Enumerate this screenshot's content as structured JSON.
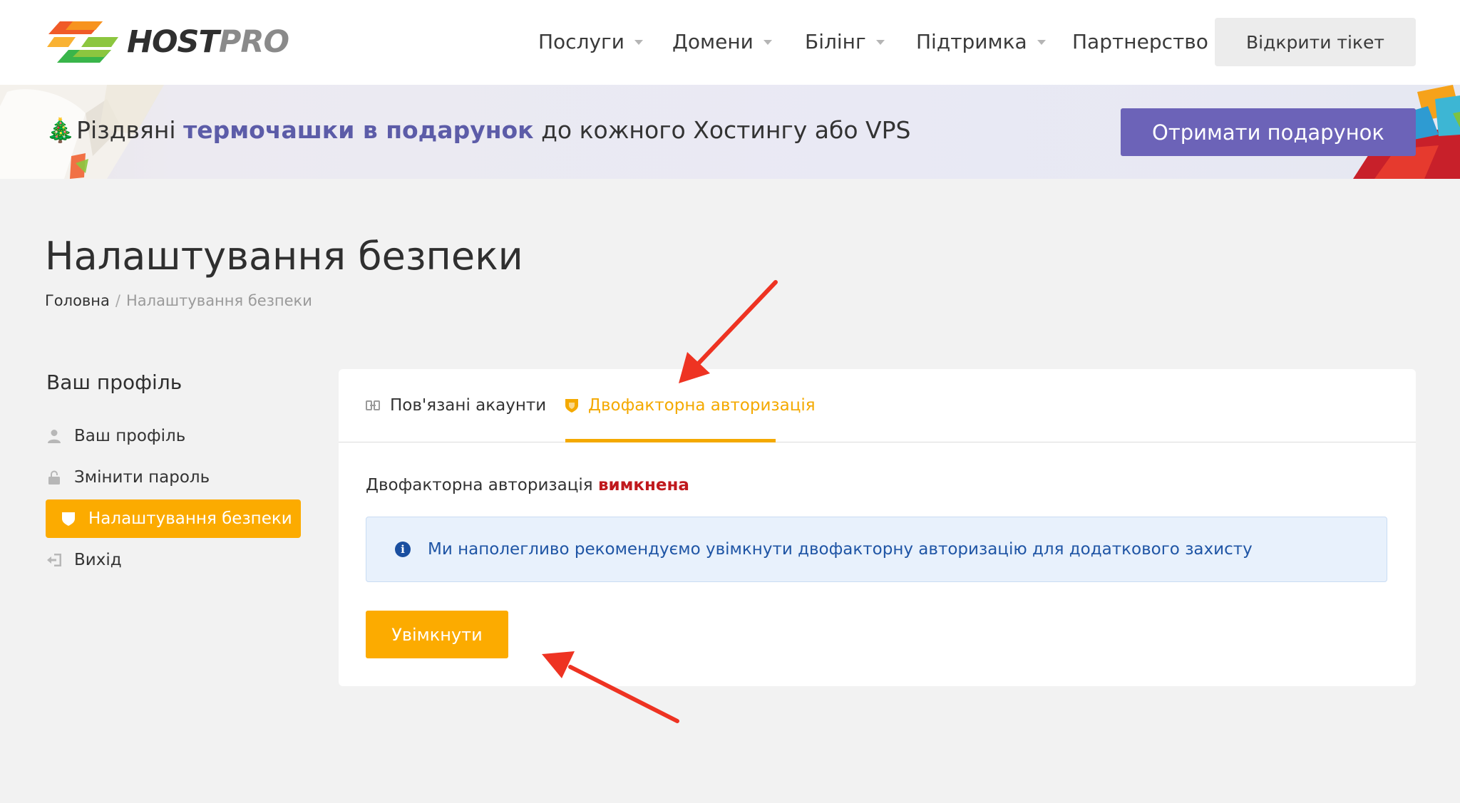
{
  "header": {
    "logo_text_host": "HOST",
    "logo_text_pro": "PRO",
    "nav": [
      {
        "label": "Послуги",
        "has_dropdown": true
      },
      {
        "label": "Домени",
        "has_dropdown": true
      },
      {
        "label": "Білінг",
        "has_dropdown": true
      },
      {
        "label": "Підтримка",
        "has_dropdown": true
      },
      {
        "label": "Партнерство",
        "has_dropdown": false
      }
    ],
    "ticket_button": "Відкрити тікет"
  },
  "banner": {
    "text_start": "Різдвяні ",
    "text_highlight": "термочашки в подарунок",
    "text_end": " до кожного Хостингу або VPS",
    "button": "Отримати подарунок"
  },
  "page": {
    "title": "Налаштування безпеки",
    "breadcrumb_home": "Головна",
    "breadcrumb_sep": "/",
    "breadcrumb_current": "Налаштування безпеки"
  },
  "sidebar": {
    "title": "Ваш профіль",
    "items": [
      {
        "label": "Ваш профіль",
        "icon": "user-icon",
        "active": false
      },
      {
        "label": "Змінити пароль",
        "icon": "lock-icon",
        "active": false
      },
      {
        "label": "Налаштування безпеки",
        "icon": "shield-icon",
        "active": true
      },
      {
        "label": "Вихід",
        "icon": "logout-icon",
        "active": false
      }
    ]
  },
  "panel": {
    "tabs": [
      {
        "label": "Пов'язані акаунти",
        "icon": "link-icon",
        "active": false
      },
      {
        "label": "Двофакторна авторизація",
        "icon": "shield-icon",
        "active": true
      }
    ],
    "status_prefix": "Двофакторна авторизація ",
    "status_value": "вимкнена",
    "alert_text": "Ми наполегливо рекомендуємо увімкнути двофакторну авторизацію для додаткового захисту",
    "enable_button": "Увімкнути"
  },
  "colors": {
    "accent": "#fcab00",
    "banner_button": "#6c63b8",
    "status_off": "#c0191d",
    "alert_bg": "#e8f1fc",
    "annotation_arrow": "#ee3322"
  }
}
